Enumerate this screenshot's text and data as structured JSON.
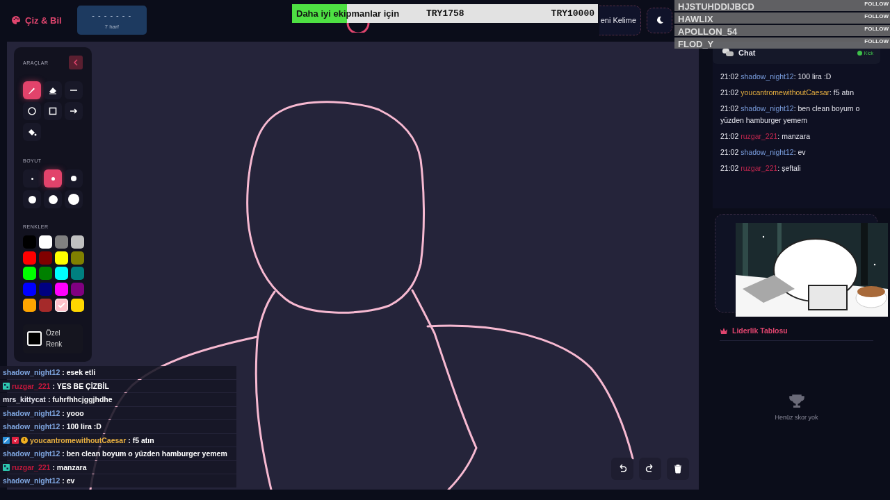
{
  "header": {
    "logo": "Çiz & Bil",
    "word_hint": "- - - - - - -",
    "letter_count": "7 harf",
    "new_word_button": "eni Kelime"
  },
  "donation_goal": {
    "label": "Daha iyi ekipmanlar için",
    "current": "TRY1758",
    "target": "TRY10000",
    "level": 0.18
  },
  "follow_overlay": [
    {
      "name": "HJSTUHDDIJBCD",
      "action": "FOLLOW"
    },
    {
      "name": "HAWLIX",
      "action": "FOLLOW"
    },
    {
      "name": "APOLLON_54",
      "action": "FOLLOW"
    },
    {
      "name": "FLOD_Y",
      "action": "FOLLOW"
    }
  ],
  "tools_panel": {
    "title": "ARAÇLAR",
    "tools": [
      {
        "kind": "brush",
        "selected": true
      },
      {
        "kind": "eraser",
        "selected": false
      },
      {
        "kind": "line",
        "selected": false
      },
      {
        "kind": "circle",
        "selected": false
      },
      {
        "kind": "rectangle",
        "selected": false
      },
      {
        "kind": "arrow",
        "selected": false
      },
      {
        "kind": "fill",
        "selected": false
      }
    ],
    "size_label": "BOYUT",
    "sizes": [
      {
        "selected": false
      },
      {
        "selected": true
      },
      {
        "selected": false
      },
      {
        "selected": false
      },
      {
        "selected": false
      },
      {
        "selected": false
      }
    ],
    "colors_label": "RENKLER",
    "colors": [
      {
        "color": "#000000",
        "selected": false
      },
      {
        "color": "#ffffff",
        "selected": false
      },
      {
        "color": "#808080",
        "selected": false
      },
      {
        "color": "#c0c0c0",
        "selected": false
      },
      {
        "color": "#ff0000",
        "selected": false
      },
      {
        "color": "#800000",
        "selected": false
      },
      {
        "color": "#ffff00",
        "selected": false
      },
      {
        "color": "#808000",
        "selected": false
      },
      {
        "color": "#00ff00",
        "selected": false
      },
      {
        "color": "#008000",
        "selected": false
      },
      {
        "color": "#00ffff",
        "selected": false
      },
      {
        "color": "#008080",
        "selected": false
      },
      {
        "color": "#0000ff",
        "selected": false
      },
      {
        "color": "#000080",
        "selected": false
      },
      {
        "color": "#ff00ff",
        "selected": false
      },
      {
        "color": "#800080",
        "selected": false
      },
      {
        "color": "#ffa500",
        "selected": false
      },
      {
        "color": "#a52a2a",
        "selected": false
      },
      {
        "color": "#ffc0cb",
        "selected": true
      },
      {
        "color": "#ffd700",
        "selected": false
      }
    ],
    "custom_color": "Özel Renk"
  },
  "stream_chat": [
    {
      "user": "shadow_night12",
      "color": "#7fa6e0",
      "text": ": esek etli"
    },
    {
      "user": "ruzgar_221",
      "color": "#c4183c",
      "text": ": YES BE ÇİZBİL",
      "badges": [
        {
          "kind": "sub"
        }
      ]
    },
    {
      "user": "mrs_kittycat",
      "color": "#e4e4ee",
      "text": ": fuhrfhhcjggjhdhe"
    },
    {
      "user": "shadow_night12",
      "color": "#7fa6e0",
      "text": ": yooo"
    },
    {
      "user": "shadow_night12",
      "color": "#7fa6e0",
      "text": ": 100 lira :D"
    },
    {
      "user": "youcantromewithoutCaesar",
      "color": "#e8b040",
      "text": ": f5 atın",
      "badges": [
        {
          "kind": "moderator"
        },
        {
          "kind": "verified"
        },
        {
          "kind": "og"
        }
      ]
    },
    {
      "user": "shadow_night12",
      "color": "#7fa6e0",
      "text": ": ben clean boyum o yüzden hamburger yemem"
    },
    {
      "user": "ruzgar_221",
      "color": "#c4183c",
      "text": ": manzara",
      "badges": [
        {
          "kind": "sub"
        }
      ]
    },
    {
      "user": "shadow_night12",
      "color": "#7fa6e0",
      "text": ": ev"
    }
  ],
  "chat": {
    "title": "Chat",
    "source": "Kick",
    "messages": [
      {
        "time": "21:02",
        "user": "shadow_night12",
        "color": "#7b9fe0",
        "text": ": 100 lira :D"
      },
      {
        "time": "21:02",
        "user": "youcantromewithoutCaesar",
        "color": "#e8b040",
        "text": ": f5 atın"
      },
      {
        "time": "21:02",
        "user": "shadow_night12",
        "color": "#7b9fe0",
        "text": ": ben clean boyum o yüzden hamburger yemem"
      },
      {
        "time": "21:02",
        "user": "ruzgar_221",
        "color": "#c0264e",
        "text": ": manzara"
      },
      {
        "time": "21:02",
        "user": "shadow_night12",
        "color": "#7b9fe0",
        "text": ": ev"
      },
      {
        "time": "21:02",
        "user": "ruzgar_221",
        "color": "#c0264e",
        "text": ": şeftali"
      }
    ]
  },
  "leaderboard": {
    "title": "Liderlik Tablosu",
    "empty": "Henüz skor yok"
  }
}
